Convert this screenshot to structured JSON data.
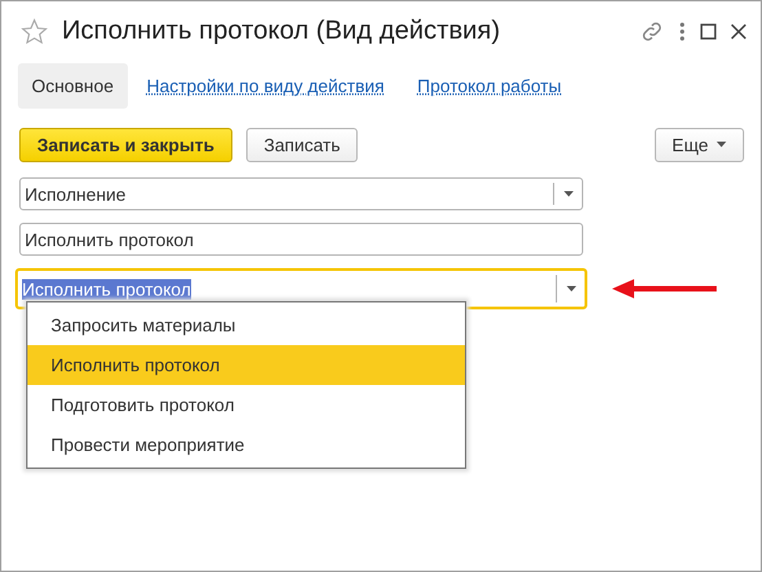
{
  "window": {
    "title": "Исполнить протокол (Вид действия)",
    "favorite": false
  },
  "tabs": [
    {
      "label": "Основное",
      "selected": true
    },
    {
      "label": "Настройки по виду действия",
      "selected": false
    },
    {
      "label": "Протокол работы",
      "selected": false
    }
  ],
  "toolbar": {
    "buttons": [
      {
        "label": "Записать и закрыть",
        "kind": "primary"
      },
      {
        "label": "Записать",
        "kind": "normal"
      }
    ],
    "more": "Еще"
  },
  "fields": [
    {
      "kind": "select",
      "value": "Исполнение",
      "focused": false
    },
    {
      "kind": "text",
      "value": "Исполнить протокол",
      "focused": false
    },
    {
      "kind": "select",
      "value": "Исполнить протокол",
      "focused": true
    }
  ],
  "dropdown": {
    "items": [
      {
        "label": "Запросить материалы",
        "selected": false
      },
      {
        "label": "Исполнить протокол",
        "selected": true
      },
      {
        "label": "Подготовить протокол",
        "selected": false
      },
      {
        "label": "Провести мероприятие",
        "selected": false
      }
    ]
  }
}
